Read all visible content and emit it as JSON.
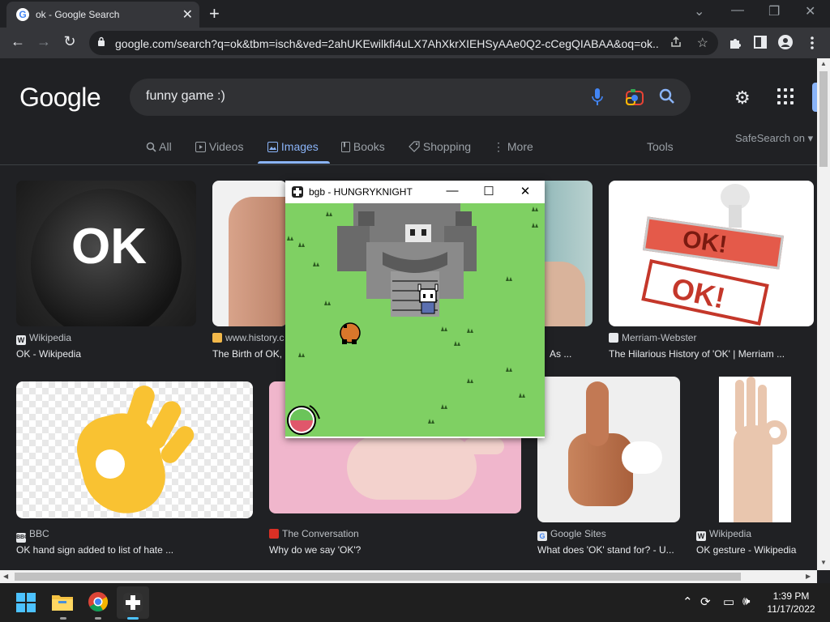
{
  "browser": {
    "tab_title": "ok - Google Search",
    "tab_close": "✕",
    "new_tab": "+",
    "window_controls": [
      "⌄",
      "—",
      "❐",
      "✕"
    ],
    "url": "google.com/search?q=ok&tbm=isch&ved=2ahUKEwilkfi4uLX7AhXkrXIEHSyAAe0Q2-cCegQIABAA&oq=ok...",
    "back_icon": "←",
    "forward_icon": "→",
    "reload_icon": "↻"
  },
  "google": {
    "logo": "Google",
    "query": "funny game :)",
    "nav_tabs": [
      {
        "icon": "search-icon",
        "label": "All"
      },
      {
        "icon": "video-icon",
        "label": "Videos"
      },
      {
        "icon": "image-icon",
        "label": "Images"
      },
      {
        "icon": "book-icon",
        "label": "Books"
      },
      {
        "icon": "tag-icon",
        "label": "Shopping"
      },
      {
        "icon": "more-icon",
        "label": "More"
      }
    ],
    "tools": "Tools",
    "safesearch": "SafeSearch on"
  },
  "results": [
    {
      "source": "Wikipedia",
      "title": "OK - Wikipedia",
      "fav": "W"
    },
    {
      "source": "www.history.c",
      "title": "The Birth of OK,",
      "fav": ""
    },
    {
      "source": "",
      "title": "As ...",
      "fav": ""
    },
    {
      "source": "Merriam-Webster",
      "title": "The Hilarious History of 'OK' | Merriam ...",
      "fav": "MW"
    },
    {
      "source": "BBC",
      "title": "OK hand sign added to list of hate ...",
      "fav": "BBC"
    },
    {
      "source": "The Conversation",
      "title": "Why do we say 'OK'?",
      "fav": ""
    },
    {
      "source": "Google Sites",
      "title": "What does 'OK' stand for? - U...",
      "fav": "G"
    },
    {
      "source": "Wikipedia",
      "title": "OK gesture - Wikipedia",
      "fav": "W"
    }
  ],
  "image_texts": {
    "ok_button": "OK",
    "stamp_top": "OK!",
    "stamp_bottom": "OK!"
  },
  "bgb": {
    "title": "bgb - HUNGRYKNIGHT",
    "minimize": "—",
    "maximize": "☐",
    "close": "✕"
  },
  "taskbar": {
    "time": "1:39 PM",
    "date": "11/17/2022",
    "apps": [
      "windows-start",
      "file-explorer",
      "chrome",
      "bgb-emulator"
    ]
  },
  "colors": {
    "accent": "#8ab4f8",
    "background": "#202124",
    "game_grass": "#7fd063"
  }
}
